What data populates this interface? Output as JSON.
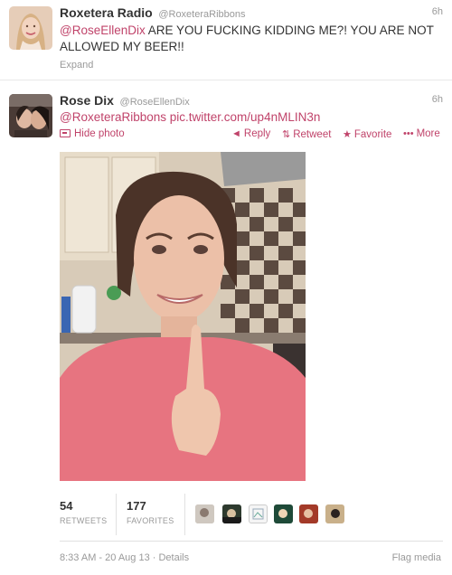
{
  "tweet1": {
    "fullname": "Roxetera Radio",
    "username": "@RoxeteraRibbons",
    "time": "6h",
    "mention": "@RoseEllenDix",
    "text": " ARE YOU FUCKING KIDDING ME?! YOU ARE NOT ALLOWED MY BEER!!",
    "expand": "Expand"
  },
  "tweet2": {
    "fullname": "Rose Dix",
    "username": "@RoseEllenDix",
    "time": "6h",
    "mention": "@RoxeteraRibbons",
    "link": "pic.twitter.com/up4nMLIN3n",
    "hide_photo": "Hide photo",
    "actions": {
      "reply": "Reply",
      "retweet": "Retweet",
      "favorite": "Favorite",
      "more": "More"
    },
    "icons": {
      "reply": "reply-arrow-icon",
      "retweet": "retweet-icon",
      "favorite": "star-icon",
      "more": "more-dots-icon",
      "media": "photo-icon"
    },
    "stats": {
      "retweets_count": "54",
      "retweets_label": "RETWEETS",
      "favorites_count": "177",
      "favorites_label": "FAVORITES"
    },
    "footer": {
      "timestamp": "8:33 AM - 20 Aug 13",
      "separator": " · ",
      "details": "Details",
      "flag": "Flag media"
    }
  },
  "colors": {
    "link": "#c0436a",
    "muted": "#999999",
    "text": "#333333"
  }
}
